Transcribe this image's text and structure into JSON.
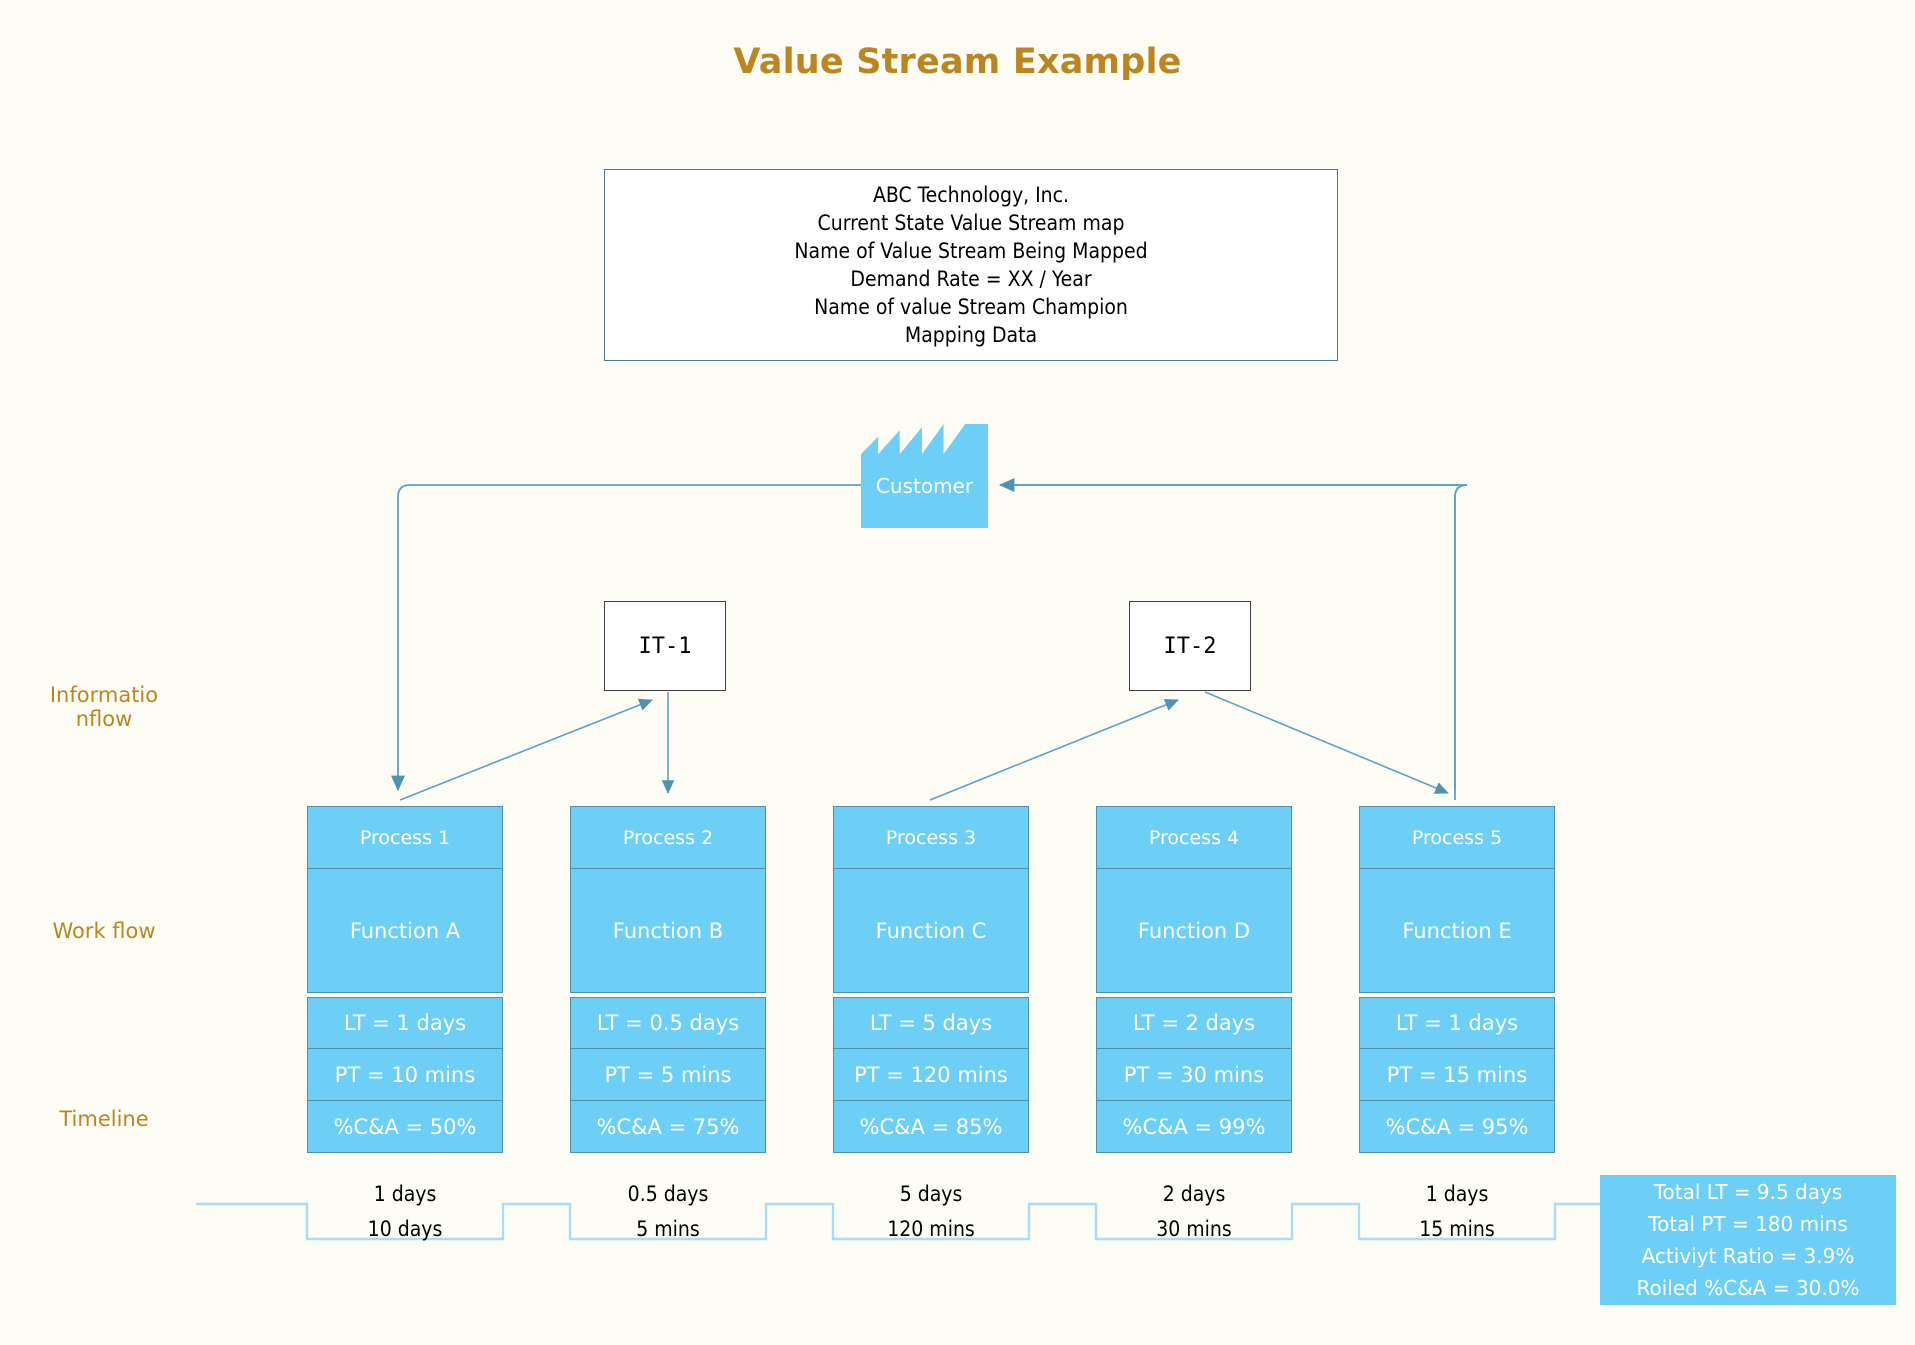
{
  "page": {
    "title": "Value Stream Example",
    "title_color": "#bb8520",
    "accent_fill": "#6dcff6",
    "accent_stroke": "#4f8fa8",
    "connector_color": "#5ba3c4",
    "background": "#fdfdf5"
  },
  "header_box": {
    "lines": [
      "ABC Technology, Inc.",
      "Current State Value Stream map",
      "Name of Value Stream Being Mapped",
      "Demand Rate = XX / Year",
      "Name of value Stream Champion",
      "Mapping Data"
    ]
  },
  "lanes": {
    "information_flow": "Informatio nflow",
    "work_flow": "Work flow",
    "timeline": "Timeline"
  },
  "customer": {
    "label": "Customer",
    "icon": "factory-icon"
  },
  "it_systems": [
    {
      "label": "IT-1"
    },
    {
      "label": "IT-2"
    }
  ],
  "processes": [
    {
      "name": "Process 1",
      "function": "Function A",
      "lt": "LT = 1 days",
      "pt": "PT = 10 mins",
      "ca": "%C&A = 50%",
      "timeline_lt": "1 days",
      "timeline_pt": "10 days"
    },
    {
      "name": "Process 2",
      "function": "Function B",
      "lt": "LT = 0.5 days",
      "pt": "PT = 5 mins",
      "ca": "%C&A = 75%",
      "timeline_lt": "0.5 days",
      "timeline_pt": "5 mins"
    },
    {
      "name": "Process 3",
      "function": "Function C",
      "lt": "LT = 5 days",
      "pt": "PT = 120 mins",
      "ca": "%C&A = 85%",
      "timeline_lt": "5 days",
      "timeline_pt": "120 mins"
    },
    {
      "name": "Process 4",
      "function": "Function D",
      "lt": "LT = 2 days",
      "pt": "PT = 30 mins",
      "ca": "%C&A = 99%",
      "timeline_lt": "2 days",
      "timeline_pt": "30 mins"
    },
    {
      "name": "Process 5",
      "function": "Function E",
      "lt": "LT = 1 days",
      "pt": "PT = 15 mins",
      "ca": "%C&A = 95%",
      "timeline_lt": "1 days",
      "timeline_pt": "15 mins"
    }
  ],
  "summary": {
    "lines": [
      "Total LT = 9.5 days",
      "Total PT = 180 mins",
      "Activiyt Ratio = 3.9%",
      "Roiled %C&A = 30.0%"
    ]
  }
}
